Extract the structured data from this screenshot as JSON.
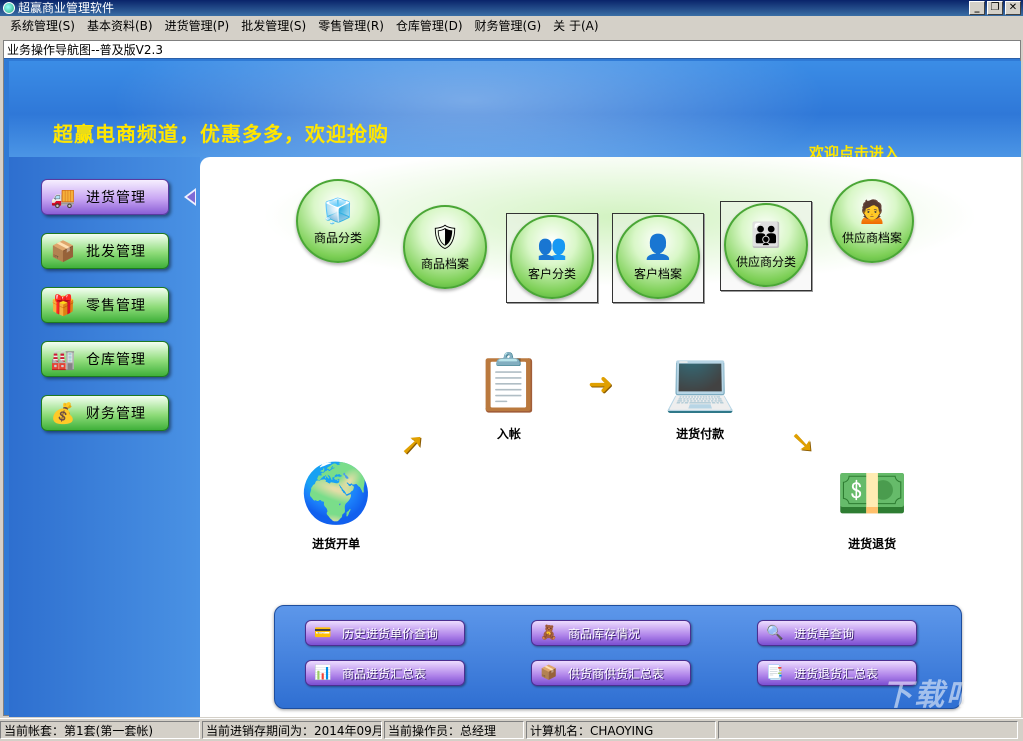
{
  "window": {
    "title": "超赢商业管理软件",
    "controls": {
      "minimize": "_",
      "restore": "❐",
      "close": "✕"
    }
  },
  "menu": [
    "系统管理(S)",
    "基本资料(B)",
    "进货管理(P)",
    "批发管理(S)",
    "零售管理(R)",
    "仓库管理(D)",
    "财务管理(G)",
    "关 于(A)"
  ],
  "nav_window": {
    "title": "业务操作导航图--普及版V2.3"
  },
  "banner": {
    "slogan": "超赢电商频道，优惠多多，欢迎抢购",
    "enter_link": "欢迎点击进入"
  },
  "sidebar": {
    "items": [
      {
        "label": "进货管理",
        "icon": "truck-icon",
        "glyph": "🚚",
        "active": true
      },
      {
        "label": "批发管理",
        "icon": "boxes-icon",
        "glyph": "📦",
        "active": false
      },
      {
        "label": "零售管理",
        "icon": "package-icon",
        "glyph": "🎁",
        "active": false
      },
      {
        "label": "仓库管理",
        "icon": "warehouse-icon",
        "glyph": "🏭",
        "active": false
      },
      {
        "label": "财务管理",
        "icon": "finance-icon",
        "glyph": "💰",
        "active": false
      }
    ]
  },
  "categories": [
    {
      "label": "商品分类",
      "icon": "cubes-icon",
      "glyph": "🧊"
    },
    {
      "label": "商品档案",
      "icon": "shield-icon",
      "glyph": "🛡"
    },
    {
      "label": "客户分类",
      "icon": "group-icon",
      "glyph": "👥"
    },
    {
      "label": "客户档案",
      "icon": "person-icon",
      "glyph": "👤"
    },
    {
      "label": "供应商分类",
      "icon": "users-icon",
      "glyph": "👪"
    },
    {
      "label": "供应商档案",
      "icon": "supplier-icon",
      "glyph": "🙍"
    }
  ],
  "flow": {
    "create_order": {
      "label": "进货开单",
      "icon": "globe-boxes-icon",
      "glyph": "🌍"
    },
    "entry": {
      "label": "入帐",
      "icon": "clipboard-icon",
      "glyph": "📋"
    },
    "payment": {
      "label": "进货付款",
      "icon": "laptop-coins-icon",
      "glyph": "💻"
    },
    "return": {
      "label": "进货退货",
      "icon": "cash-briefcase-icon",
      "glyph": "💵"
    },
    "arrows": {
      "up_right": "➚",
      "right": "➜",
      "down_right": "➘"
    }
  },
  "queries": [
    {
      "label": "历史进货单价查询",
      "icon": "price-history-icon",
      "glyph": "💳"
    },
    {
      "label": "商品库存情况",
      "icon": "stock-icon",
      "glyph": "🧸"
    },
    {
      "label": "进货单查询",
      "icon": "order-search-icon",
      "glyph": "🔍"
    },
    {
      "label": "商品进货汇总表",
      "icon": "pie-chart-icon",
      "glyph": "📊"
    },
    {
      "label": "供货商供货汇总表",
      "icon": "supply-summary-icon",
      "glyph": "📦"
    },
    {
      "label": "进货退货汇总表",
      "icon": "return-summary-icon",
      "glyph": "📑"
    }
  ],
  "status": {
    "account": "当前帐套：第1套(第一套帐)",
    "period": "当前进销存期间为：2014年09月",
    "operator": "当前操作员：总经理",
    "machine": "计算机名：CHAOYING"
  },
  "watermark": "下载吧"
}
